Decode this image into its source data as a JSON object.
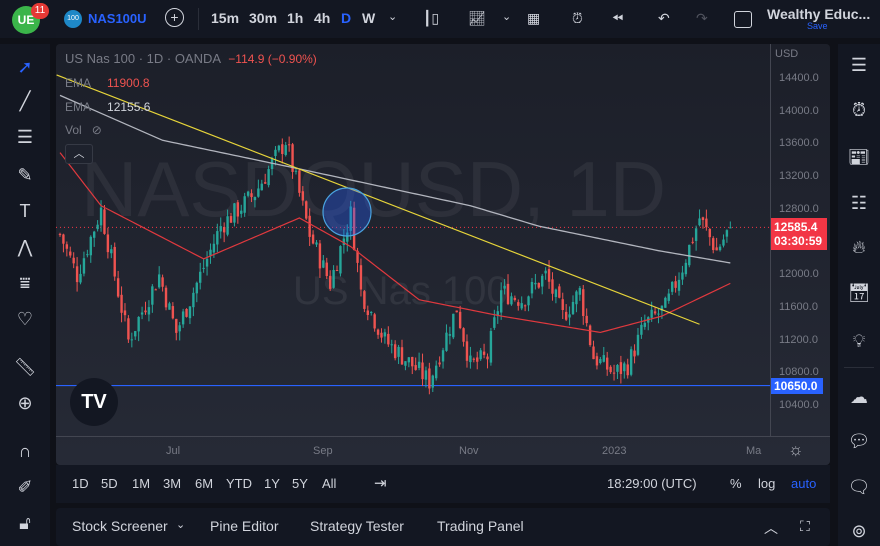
{
  "topbar": {
    "notif_count": "11",
    "symbol_badge": "100",
    "symbol": "NAS100U",
    "intervals": [
      "15m",
      "30m",
      "1h",
      "4h",
      "D",
      "W"
    ],
    "active_interval": "D",
    "layout_name": "Wealthy Educ...",
    "save_label": "Save"
  },
  "legend": {
    "title": "US Nas 100 · 1D · OANDA",
    "change": "−114.9 (−0.90%)",
    "ema1_label": "EMA",
    "ema1_value": "11900.8",
    "ema2_label": "EMA",
    "ema2_value": "12155.6",
    "vol_label": "Vol"
  },
  "watermark": {
    "main": "NASDQUSD, 1D",
    "sub": "US Nas 100"
  },
  "price_axis": {
    "currency": "USD",
    "ticks": [
      "14400.0",
      "14000.0",
      "13600.0",
      "13200.0",
      "12800.0",
      "12000.0",
      "11600.0",
      "11200.0",
      "10800.0",
      "10400.0"
    ],
    "last_price": "12585.4",
    "countdown": "03:30:59",
    "hline_price": "10650.0"
  },
  "time_axis": {
    "labels": [
      "Jul",
      "Sep",
      "Nov",
      "2023",
      "Ma"
    ]
  },
  "bottom": {
    "ranges": [
      "1D",
      "5D",
      "1M",
      "3M",
      "6M",
      "YTD",
      "1Y",
      "5Y",
      "All"
    ],
    "clock": "18:29:00 (UTC)",
    "pct": "%",
    "log": "log",
    "auto": "auto"
  },
  "panel": {
    "tabs": [
      "Stock Screener",
      "Pine Editor",
      "Strategy Tester",
      "Trading Panel"
    ]
  },
  "colors": {
    "up": "#26a69a",
    "down": "#ef5350",
    "accent": "#2962ff",
    "ema_fast": "#e0393e",
    "ema_slow": "#b2b5be",
    "trend": "#e6d43a"
  },
  "chart_data": {
    "type": "candlestick",
    "ylim": [
      10200,
      14600
    ],
    "hline": 10650,
    "last": 12585.4,
    "keypoints": [
      [
        0,
        12500
      ],
      [
        5,
        12000
      ],
      [
        12,
        12800
      ],
      [
        20,
        11200
      ],
      [
        29,
        12000
      ],
      [
        34,
        11300
      ],
      [
        41,
        12000
      ],
      [
        47,
        12600
      ],
      [
        57,
        13000
      ],
      [
        66,
        13650
      ],
      [
        73,
        12500
      ],
      [
        79,
        11900
      ],
      [
        85,
        12750
      ],
      [
        88,
        11800
      ],
      [
        95,
        11200
      ],
      [
        103,
        10900
      ],
      [
        108,
        10700
      ],
      [
        116,
        11600
      ],
      [
        120,
        10900
      ],
      [
        125,
        11000
      ],
      [
        129,
        11800
      ],
      [
        135,
        11700
      ],
      [
        142,
        12000
      ],
      [
        147,
        11500
      ],
      [
        152,
        11800
      ],
      [
        156,
        11000
      ],
      [
        162,
        10800
      ],
      [
        166,
        10900
      ],
      [
        171,
        11400
      ],
      [
        177,
        11600
      ],
      [
        182,
        12100
      ],
      [
        187,
        12700
      ],
      [
        192,
        12300
      ],
      [
        196,
        12585
      ]
    ],
    "ema_slow": [
      [
        0,
        14200
      ],
      [
        30,
        13650
      ],
      [
        70,
        13300
      ],
      [
        120,
        12850
      ],
      [
        140,
        12600
      ],
      [
        175,
        12300
      ],
      [
        196,
        12150
      ]
    ],
    "ema_fast": [
      [
        0,
        13500
      ],
      [
        12,
        12850
      ],
      [
        42,
        12200
      ],
      [
        70,
        12700
      ],
      [
        85,
        12350
      ],
      [
        105,
        11700
      ],
      [
        129,
        11500
      ],
      [
        158,
        11300
      ],
      [
        176,
        11500
      ],
      [
        196,
        11900
      ]
    ],
    "trendline": [
      [
        -1,
        14450
      ],
      [
        187,
        11400
      ]
    ]
  }
}
